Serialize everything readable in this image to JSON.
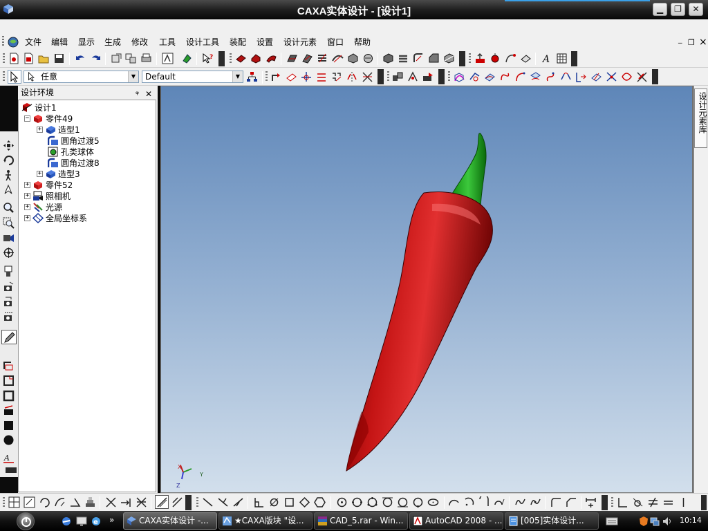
{
  "window": {
    "title": "CAXA实体设计 - [设计1]",
    "minimize": "▁",
    "restore": "❐",
    "close": "✕"
  },
  "menu": {
    "items": [
      "文件",
      "编辑",
      "显示",
      "生成",
      "修改",
      "工具",
      "设计工具",
      "装配",
      "设置",
      "设计元素",
      "窗口",
      "帮助"
    ],
    "mdi_min": "_",
    "mdi_restore": "❐",
    "mdi_close": "×"
  },
  "selector": {
    "filter_value": "任意",
    "style_value": "Default"
  },
  "tree_panel": {
    "title": "设计环境",
    "pin": "ᵠ",
    "close": "✕",
    "nodes": [
      {
        "label": "设计1",
        "expander": ""
      },
      {
        "label": "零件49",
        "expander": "−"
      },
      {
        "label": "造型1",
        "expander": "+"
      },
      {
        "label": "圆角过渡5",
        "expander": ""
      },
      {
        "label": "孔类球体",
        "expander": ""
      },
      {
        "label": "圆角过渡8",
        "expander": ""
      },
      {
        "label": "造型3",
        "expander": "+"
      },
      {
        "label": "零件52",
        "expander": "+"
      },
      {
        "label": "照相机",
        "expander": "+"
      },
      {
        "label": "光源",
        "expander": "+"
      },
      {
        "label": "全局坐标系",
        "expander": "+"
      }
    ]
  },
  "viewport": {
    "axis_x": "X",
    "axis_y": "Y",
    "axis_z": "Z"
  },
  "library_tab": {
    "label": "设计元素库"
  },
  "taskbar": {
    "tasks": [
      {
        "label": "CAXA实体设计 -...",
        "active": true
      },
      {
        "label": "★CAXA版块 \"设...",
        "active": false
      },
      {
        "label": "CAD_5.rar - Win...",
        "active": false
      },
      {
        "label": "AutoCAD 2008 - ...",
        "active": false
      },
      {
        "label": "[005]实体设计...",
        "active": false
      }
    ],
    "more": "»",
    "clock": "10:14"
  },
  "colors": {
    "pepper_red": "#b01010",
    "stem_green": "#1faa1f",
    "viewport_top": "#5e86b8",
    "viewport_bottom": "#d2dfec"
  }
}
